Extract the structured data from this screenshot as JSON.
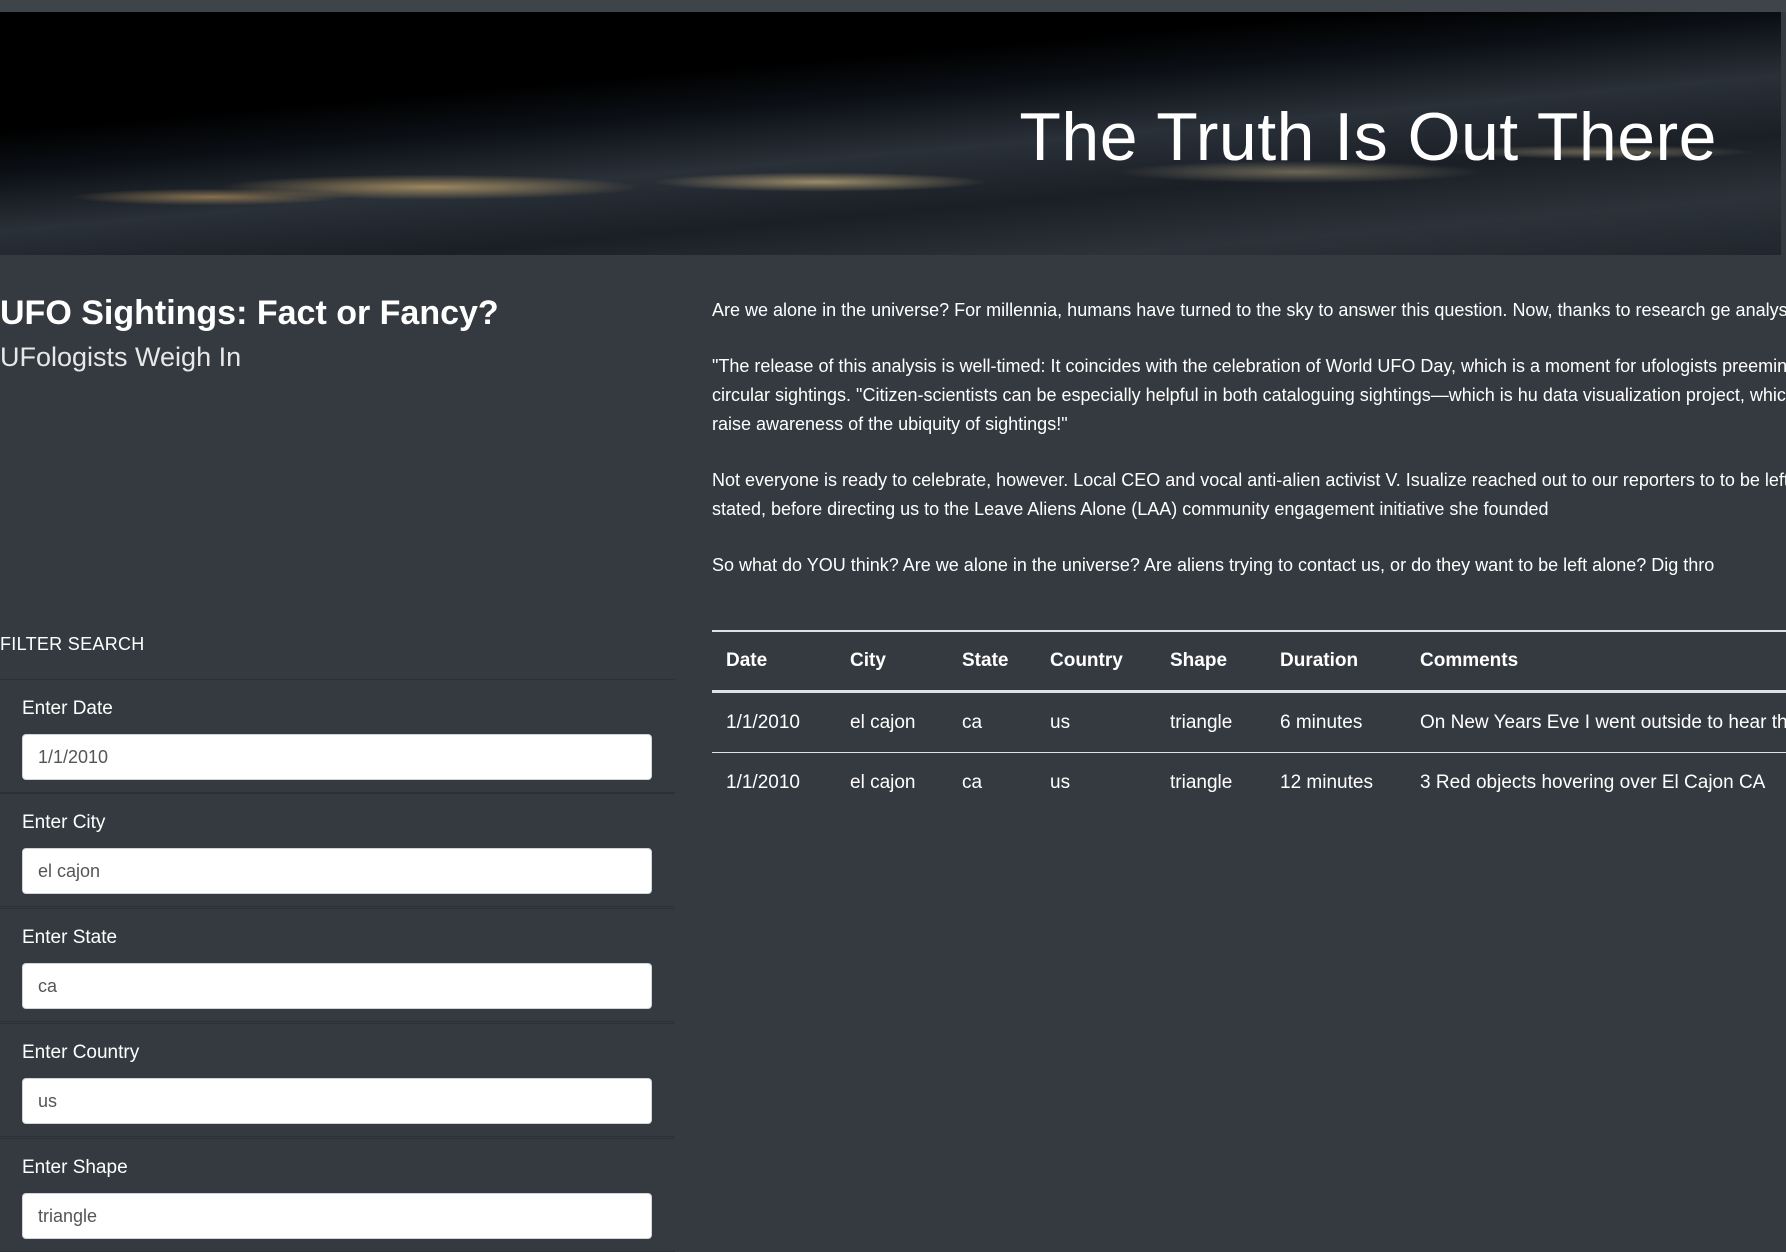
{
  "hero": {
    "title": "The Truth Is Out There"
  },
  "intro": {
    "title": "UFO Sightings: Fact or Fancy?",
    "subtitle": "UFologists Weigh In"
  },
  "article": {
    "paragraphs": [
      "Are we alone in the universe? For millennia, humans have turned to the sky to answer this question. Now, thanks to research ge analysis.",
      "\"The release of this analysis is well-timed: It coincides with the celebration of World UFO Day, which is a moment for ufologists preeminent expert on circular sightings. \"Citizen-scientists can be especially helpful in both cataloguing sightings—which is hu data visualization project, which will help us raise awareness of the ubiquity of sightings!\"",
      "Not everyone is ready to celebrate, however. Local CEO and vocal anti-alien activist V. Isualize reached out to our reporters to to be left alone,\" she stated, before directing us to the Leave Aliens Alone (LAA) community engagement initiative she founded",
      "So what do YOU think? Are we alone in the universe? Are aliens trying to contact us, or do they want to be left alone? Dig thro"
    ]
  },
  "filter": {
    "title": "FILTER SEARCH",
    "fields": [
      {
        "label": "Enter Date",
        "value": "1/1/2010"
      },
      {
        "label": "Enter City",
        "value": "el cajon"
      },
      {
        "label": "Enter State",
        "value": "ca"
      },
      {
        "label": "Enter Country",
        "value": "us"
      },
      {
        "label": "Enter Shape",
        "value": "triangle"
      }
    ]
  },
  "table": {
    "headers": [
      "Date",
      "City",
      "State",
      "Country",
      "Shape",
      "Duration",
      "Comments"
    ],
    "rows": [
      [
        "1/1/2010",
        "el cajon",
        "ca",
        "us",
        "triangle",
        "6 minutes",
        "On New Years Eve I went outside to hear th"
      ],
      [
        "1/1/2010",
        "el cajon",
        "ca",
        "us",
        "triangle",
        "12 minutes",
        "3 Red objects hovering over El Cajon CA"
      ]
    ]
  }
}
